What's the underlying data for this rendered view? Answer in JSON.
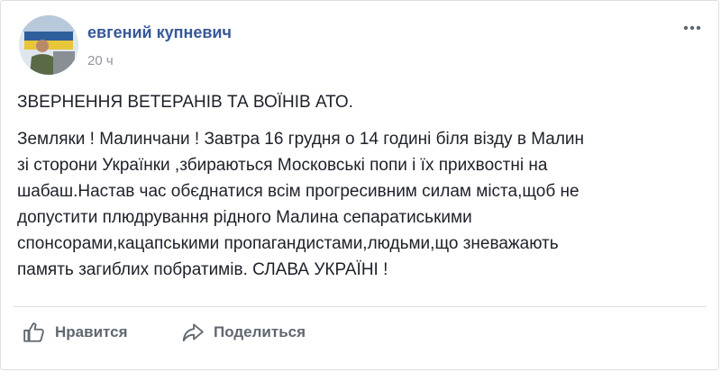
{
  "post": {
    "author": "евгений купневич",
    "time": "20 ч",
    "title": "ЗВЕРНЕННЯ ВЕТЕРАНІВ ТА ВОЇНІВ АТО.",
    "body_lines": [
      "Земляки ! Малинчани ! Завтра 16 грудня о 14 годині біля візду в Малин",
      "зі сторони Українки ,збираються Московські попи і їх прихвостні на",
      "шабаш.Настав час обєднатися всім прогресивним силам міста,щоб не",
      "допустити плюдрування рідного Малина сепаратиськими",
      "спонсорами,кацапськими пропагандистами,людьми,що зневажають",
      "память загиблих побратимів. СЛАВА УКРАЇНІ !"
    ]
  },
  "actions": {
    "like_label": "Нравится",
    "share_label": "Поделиться"
  },
  "icons": {
    "like": "thumbs-up-icon",
    "share": "share-arrow-icon",
    "more": "more-options-icon"
  },
  "colors": {
    "author_link": "#365899",
    "meta_text": "#90949c",
    "action_text": "#606770"
  }
}
